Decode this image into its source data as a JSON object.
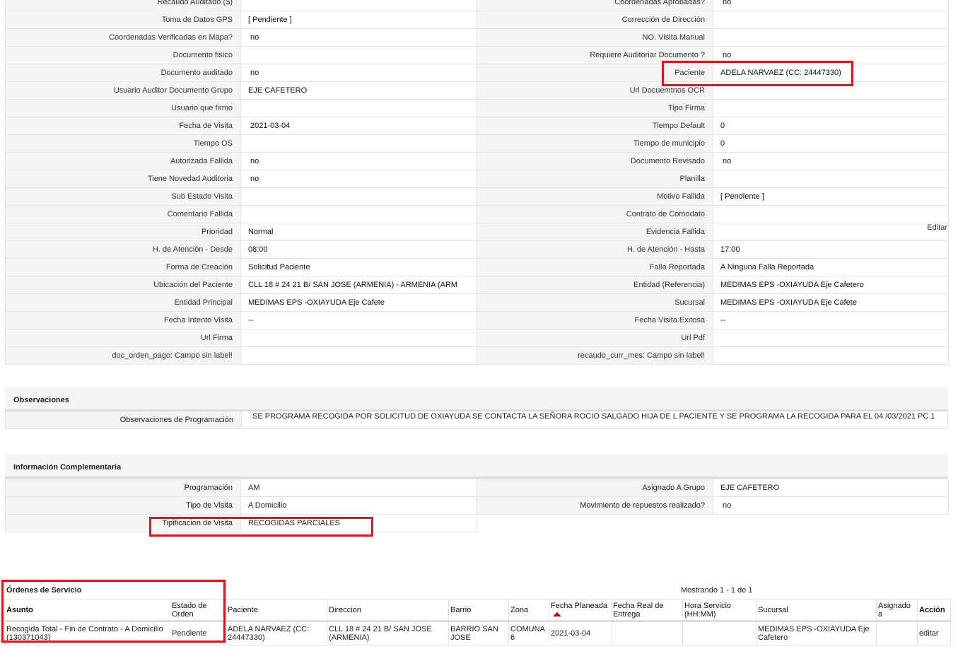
{
  "detail_rows": [
    {
      "l1": "Recaudo Auditado ($)",
      "v1": "",
      "l2": "Coordenadas Aprobadas?",
      "v2": "no"
    },
    {
      "l1": "Toma de Datos GPS",
      "v1": "[ Pendiente ]",
      "l2": "Corrección de Dirección",
      "v2": ""
    },
    {
      "l1": "Coordenadas Verificadas en Mapa?",
      "v1": "no",
      "l2": "NO. Visita Manual",
      "v2": ""
    },
    {
      "l1": "Documento fisico",
      "v1": "",
      "l2": "Requiere Auditoriar Documento ?",
      "v2": "no"
    },
    {
      "l1": "Documento auditado",
      "v1": "no",
      "l2": "Paciente",
      "v2": "ADELA NARVAEZ (CC: 24447330)"
    },
    {
      "l1": "Usuario Auditor Documento Grupo",
      "v1": "EJE CAFETERO",
      "l2": "Url Docuemtnos OCR",
      "v2": ""
    },
    {
      "l1": "Usuario que firmo",
      "v1": "",
      "l2": "Tipo Firma",
      "v2": ""
    },
    {
      "l1": "Fecha de Visita",
      "v1": "2021-03-04",
      "l2": "Tiempo Default",
      "v2": "0"
    },
    {
      "l1": "Tiempo OS",
      "v1": "",
      "l2": "Tiempo de municipio",
      "v2": "0"
    },
    {
      "l1": "Autorizada Fallida",
      "v1": "no",
      "l2": "Documento Revisado",
      "v2": "no"
    },
    {
      "l1": "Tiene Novedad Auditoria",
      "v1": "no",
      "l2": "Planilla",
      "v2": ""
    },
    {
      "l1": "Sub Estado Visita",
      "v1": "",
      "l2": "Motivo Fallida",
      "v2": "[ Pendiente ]"
    },
    {
      "l1": "Comentario Fallida",
      "v1": "",
      "l2": "Contrato de Comodato",
      "v2": ""
    },
    {
      "l1": "Prioridad",
      "v1": "Normal",
      "l2": "Evidencia Fallida",
      "v2": ""
    },
    {
      "l1": "H. de Atención - Desde",
      "v1": "08:00",
      "l2": "H. de Atención - Hasta",
      "v2": "17:00"
    },
    {
      "l1": "Forma de Creación",
      "v1": "Solicitud Paciente",
      "l2": "Falla Reportada",
      "v2": "A Ninguna Falla Reportada"
    },
    {
      "l1": "Ubicación del Paciente",
      "v1": "CLL 18 # 24 21 B/ SAN JOSE (ARMENIA) - ARMENIA (ARM",
      "l2": "Entidad (Referencia)",
      "v2": "MEDIMAS EPS -OXIAYUDA Eje Cafetero"
    },
    {
      "l1": "Entidad Principal",
      "v1": "MEDIMAS EPS -OXIAYUDA Eje Cafete",
      "l2": "Sucursal",
      "v2": "MEDIMAS EPS -OXIAYUDA Eje Cafete"
    },
    {
      "l1": "Fecha Intento Visita",
      "v1": "--",
      "l2": "Fecha Visita Exitosa",
      "v2": "--"
    },
    {
      "l1": "Url Firma",
      "v1": "",
      "l2": "Url Pdf",
      "v2": ""
    },
    {
      "l1": "doc_orden_pago: Campo sin label!",
      "v1": "",
      "l2": "recaudo_curr_mes: Campo sin label!",
      "v2": ""
    }
  ],
  "edit_label": "Editar",
  "observaciones": {
    "title": "Observaciones",
    "label": "Observaciones de Programación",
    "value": "SE PROGRAMA RECOGIDA POR SOLICITUD DE OXIAYUDA SE CONTACTA LA SEÑORA ROCIO SALGADO HIJA DE L PACIENTE Y SE PROGRAMA LA RECOGIDA PARA EL 04 /03/2021 PC 1"
  },
  "info": {
    "title": "Información Complementaria",
    "programacion_label": "Programación",
    "programacion": "AM",
    "asignado_label": "Asignado A Grupo",
    "asignado": "EJE CAFETERO",
    "tipo_label": "Tipo de Visita",
    "tipo": "A Domicilio",
    "movimiento_label": "Movimiento de repuestos realizado?",
    "movimiento": "no",
    "tipificacion_label": "Tipificacion de Visita",
    "tipificacion": "RECOGIDAS PARCIALES"
  },
  "orders": {
    "title": "Órdenes de Servicio",
    "count": "Mostrando 1 - 1 de 1",
    "headers": {
      "asunto": "Asunto",
      "estado": "Estado de Orden",
      "paciente": "Paciente",
      "direccion": "Direccion",
      "barrio": "Barrio",
      "zona": "Zona",
      "fecha_planeada": "Fecha Planeada",
      "fecha_real": "Fecha Real de Entrega",
      "hora": "Hora Servicio (HH:MM)",
      "sucursal": "Sucursal",
      "asignado": "Asignado a",
      "accion": "Acción"
    },
    "row": {
      "asunto": "Recogida Total - Fin de Contrato - A Domicilio (130371043)",
      "estado": "Pendiente",
      "paciente": "ADELA NARVAEZ (CC: 24447330)",
      "direccion": "CLL 18 # 24 21 B/ SAN JOSE (ARMENIA)",
      "barrio": "BARRIO SAN JOSE",
      "zona": "COMUNA 6",
      "fecha_planeada": "2021-03-04",
      "fecha_real": "",
      "hora": "",
      "sucursal": "MEDIMAS EPS -OXIAYUDA Eje Cafetero",
      "asignado": "",
      "accion": "editar"
    }
  },
  "colors": {
    "highlight": "#e0141e",
    "label_bg": "#f4f4f4",
    "border": "#e3e3e3"
  }
}
